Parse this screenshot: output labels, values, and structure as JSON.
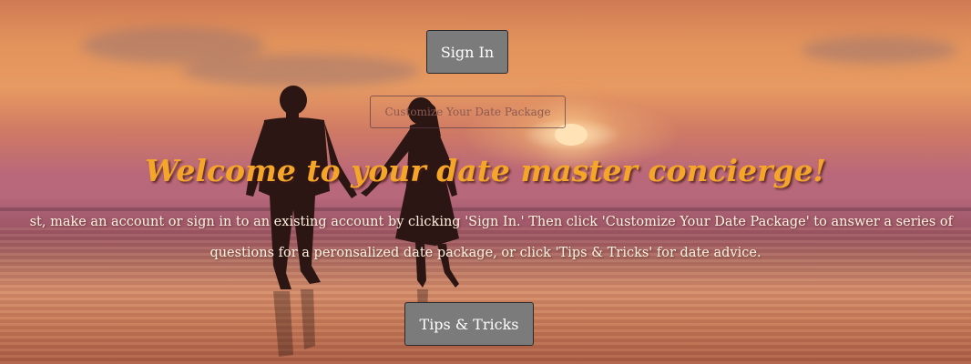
{
  "header": {
    "sign_in_label": "Sign In",
    "customize_label": "Customize Your Date Package"
  },
  "main": {
    "headline": "Welcome to your date master concierge!",
    "instructions_line1": "st, make an account or sign in to an existing account by clicking 'Sign In.' Then click 'Customize Your Date Package' to answer a series of",
    "instructions_line2": "questions for a peronsalized date package, or click 'Tips & Tricks' for date advice."
  },
  "footer": {
    "tips_label": "Tips & Tricks"
  },
  "colors": {
    "headline": "#f5a629",
    "button_bg": "#7b7b7b",
    "button_text": "#ffffff"
  }
}
